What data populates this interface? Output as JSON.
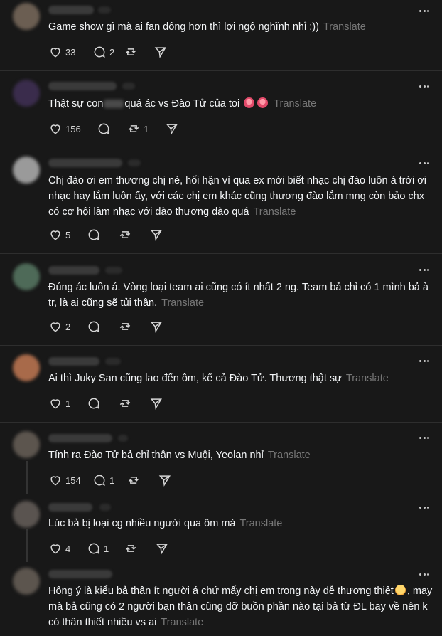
{
  "translate_label": "Translate",
  "posts": [
    {
      "text": "Game show gì mà ai fan đông hơn thì lợi ngộ nghĩnh nhỉ :))",
      "likes": "33",
      "replies": "2",
      "reposts": "",
      "avatar_color": "#6b5e52"
    },
    {
      "text_before": "Thật sự con",
      "text_after": "quá ác vs Đào Tử của toi",
      "likes": "156",
      "replies": "",
      "reposts": "1",
      "avatar_color": "#3a2c4c"
    },
    {
      "text": "Chị đào ơi em thương chị nè, hối hận vì qua ex mới biết nhạc chị đào luôn á trời ơi nhạc hay lắm luôn ấy, với các chị em khác cũng thương đào lắm mng còn bảo chx có cơ hội làm nhạc với đào thương đào quá",
      "likes": "5",
      "replies": "",
      "reposts": "",
      "avatar_color": "#9a9a9a"
    },
    {
      "text": "Đúng ác luôn á. Vòng loại team ai cũng có ít nhất 2 ng. Team bả chỉ có 1 mình bả à tr, là ai cũng sẽ tủi thân.",
      "likes": "2",
      "replies": "",
      "reposts": "",
      "avatar_color": "#4e6a58"
    },
    {
      "text": "Ai thì Juky San cũng lao đến ôm, kể cả Đào Tử. Thương thật sự",
      "likes": "1",
      "replies": "",
      "reposts": "",
      "avatar_color": "#a86a4a"
    },
    {
      "text": "Tính ra Đào Tử bả chỉ thân vs Muội, Yeolan nhỉ",
      "likes": "154",
      "replies": "1",
      "reposts": "",
      "avatar_color": "#5c554e"
    },
    {
      "text": "Lúc bả bị loại cg nhiều người qua ôm mà",
      "likes": "4",
      "replies": "1",
      "reposts": "",
      "avatar_color": "#5a5450"
    },
    {
      "text_before": "Hông ý là kiểu bả thân ít người á chứ mấy chị em trong này dễ thương thiệt",
      "text_after": ", may mà bả cũng có 2 người bạn thân cũng đỡ buồn phần nào tại bả từ ĐL bay về nên k có thân thiết nhiều vs ai",
      "likes": "",
      "replies": "",
      "reposts": "",
      "avatar_color": "#5c554e"
    }
  ]
}
